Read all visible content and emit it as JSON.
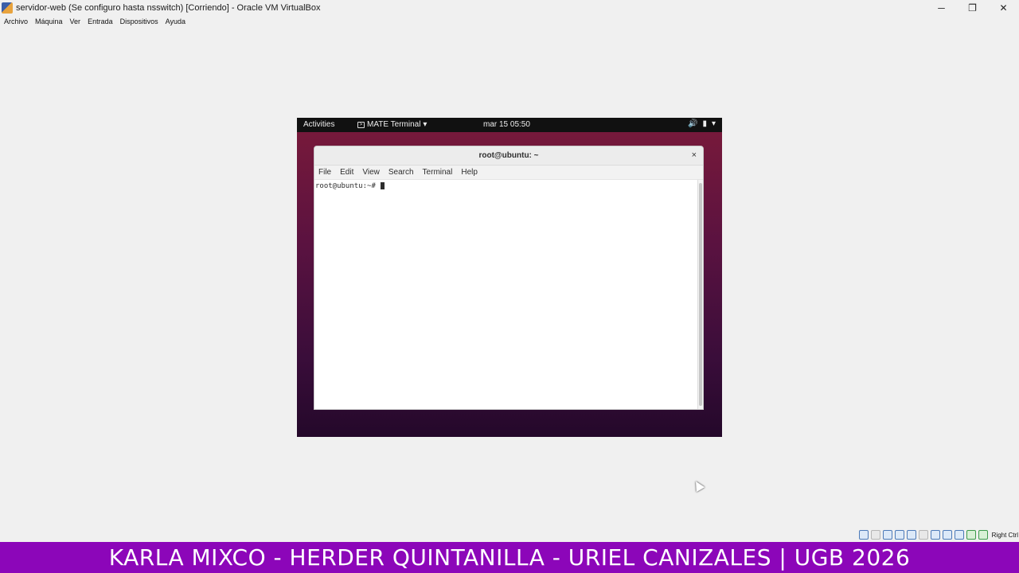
{
  "window": {
    "title": "servidor-web (Se configuro hasta nsswitch) [Corriendo] - Oracle VM VirtualBox",
    "controls": {
      "minimize": "─",
      "restore": "❐",
      "close": "✕"
    }
  },
  "menubar": [
    "Archivo",
    "Máquina",
    "Ver",
    "Entrada",
    "Dispositivos",
    "Ayuda"
  ],
  "guest": {
    "topbar": {
      "activities": "Activities",
      "app_menu": "MATE Terminal",
      "app_menu_arrow": "▾",
      "clock": "mar 15  05:50",
      "tray": {
        "volume": "🔊",
        "battery": "▮",
        "arrow": "▾"
      }
    },
    "terminal": {
      "title": "root@ubuntu: ~",
      "close": "×",
      "menu": [
        "File",
        "Edit",
        "View",
        "Search",
        "Terminal",
        "Help"
      ],
      "prompt": "root@ubuntu:~# "
    }
  },
  "statusbar": {
    "host_key": "Right Ctrl"
  },
  "banner": {
    "text": "KARLA MIXCO - HERDER QUINTANILLA - URIEL CANIZALES | UGB 2026"
  },
  "colors": {
    "banner": "#8c06b9",
    "guest_gradient_top": "#7a1a3a",
    "guest_gradient_bottom": "#24082a"
  }
}
